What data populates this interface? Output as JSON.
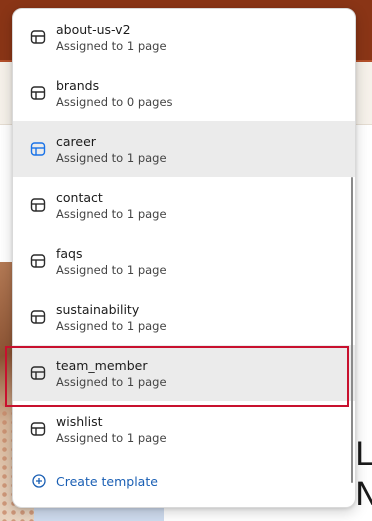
{
  "templates": [
    {
      "name": "about-us-v2",
      "assigned": "Assigned to 1 page",
      "icon": "template-icon"
    },
    {
      "name": "brands",
      "assigned": "Assigned to 0 pages",
      "icon": "template-icon"
    },
    {
      "name": "career",
      "assigned": "Assigned to 1 page",
      "icon": "template-icon-selected"
    },
    {
      "name": "contact",
      "assigned": "Assigned to 1 page",
      "icon": "template-icon"
    },
    {
      "name": "faqs",
      "assigned": "Assigned to 1 page",
      "icon": "template-icon"
    },
    {
      "name": "sustainability",
      "assigned": "Assigned to 1 page",
      "icon": "template-icon"
    },
    {
      "name": "team_member",
      "assigned": "Assigned to 1 page",
      "icon": "template-icon"
    },
    {
      "name": "wishlist",
      "assigned": "Assigned to 1 page",
      "icon": "template-icon"
    }
  ],
  "create_template_label": "Create template",
  "background_heading": [
    "L",
    "N"
  ],
  "colors": {
    "accent": "#1a5fb4",
    "selected_icon": "#1a73e8",
    "highlight_outline": "#c8102e",
    "topbar": "#8a3516"
  }
}
